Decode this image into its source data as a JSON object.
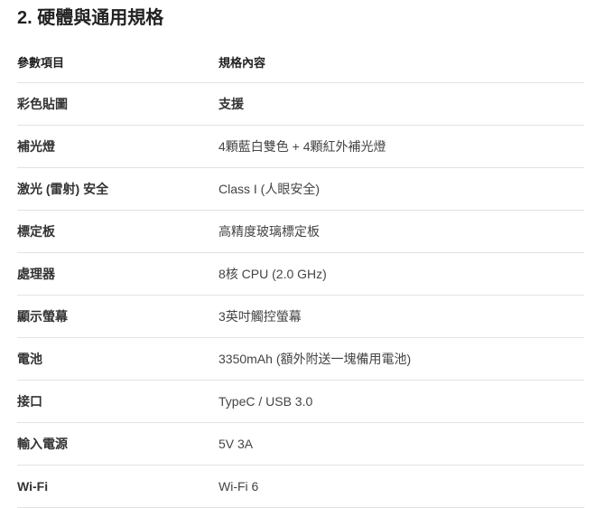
{
  "section": {
    "title": "2. 硬體與通用規格"
  },
  "table": {
    "headers": [
      "參數項目",
      "規格內容"
    ],
    "rows": [
      {
        "item": "彩色貼圖",
        "value": "支援"
      },
      {
        "item": "補光燈",
        "value": "4顆藍白雙色 + 4顆紅外補光燈"
      },
      {
        "item": "激光 (雷射) 安全",
        "value": "Class I (人眼安全)"
      },
      {
        "item": "標定板",
        "value": "高精度玻璃標定板"
      },
      {
        "item": "處理器",
        "value": "8核 CPU (2.0 GHz)"
      },
      {
        "item": "顯示螢幕",
        "value": "3英吋觸控螢幕"
      },
      {
        "item": "電池",
        "value": "3350mAh (額外附送一塊備用電池)"
      },
      {
        "item": "接口",
        "value": "TypeC / USB 3.0"
      },
      {
        "item": "輸入電源",
        "value": "5V 3A"
      },
      {
        "item": "Wi-Fi",
        "value": "Wi-Fi 6"
      }
    ]
  }
}
